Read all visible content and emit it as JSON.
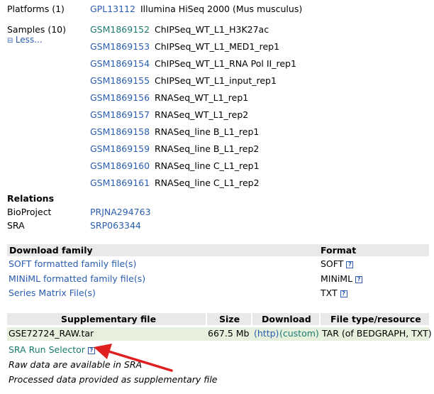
{
  "platforms": {
    "label": "Platforms (1)",
    "id": "GPL13112",
    "desc": "Illumina HiSeq 2000 (Mus musculus)"
  },
  "samples": {
    "label": "Samples (10)",
    "less": "Less...",
    "items": [
      {
        "id": "GSM1869152",
        "name": "ChIPSeq_WT_L1_H3K27ac"
      },
      {
        "id": "GSM1869153",
        "name": "ChIPSeq_WT_L1_MED1_rep1"
      },
      {
        "id": "GSM1869154",
        "name": "ChIPSeq_WT_L1_RNA Pol II_rep1"
      },
      {
        "id": "GSM1869155",
        "name": "ChIPSeq_WT_L1_input_rep1"
      },
      {
        "id": "GSM1869156",
        "name": "RNASeq_WT_L1_rep1"
      },
      {
        "id": "GSM1869157",
        "name": "RNASeq_WT_L1_rep2"
      },
      {
        "id": "GSM1869158",
        "name": "RNASeq_line B_L1_rep1"
      },
      {
        "id": "GSM1869159",
        "name": "RNASeq_line B_L1_rep2"
      },
      {
        "id": "GSM1869160",
        "name": "RNASeq_line C_L1_rep1"
      },
      {
        "id": "GSM1869161",
        "name": "RNASeq_line C_L1_rep2"
      }
    ]
  },
  "relations": {
    "title": "Relations",
    "bioproject_label": "BioProject",
    "bioproject_id": "PRJNA294763",
    "sra_label": "SRA",
    "sra_id": "SRP063344"
  },
  "download_family": {
    "header": "Download family",
    "format_header": "Format",
    "rows": [
      {
        "label": "SOFT formatted family file(s)",
        "format": "SOFT"
      },
      {
        "label": "MINiML formatted family file(s)",
        "format": "MINiML"
      },
      {
        "label": "Series Matrix File(s)",
        "format": "TXT"
      }
    ],
    "help_glyph": "?"
  },
  "supplementary": {
    "headers": {
      "file": "Supplementary file",
      "size": "Size",
      "download": "Download",
      "type": "File type/resource"
    },
    "row": {
      "file": "GSE72724_RAW.tar",
      "size": "667.5 Mb",
      "http": "(http)",
      "custom": "(custom)",
      "type": "TAR (of BEDGRAPH, TXT)"
    },
    "sra_selector": "SRA Run Selector",
    "note_raw": "Raw data are available in SRA",
    "note_processed": "Processed data provided as supplementary file"
  },
  "annotation": {
    "arrow_color": "#e02020"
  }
}
